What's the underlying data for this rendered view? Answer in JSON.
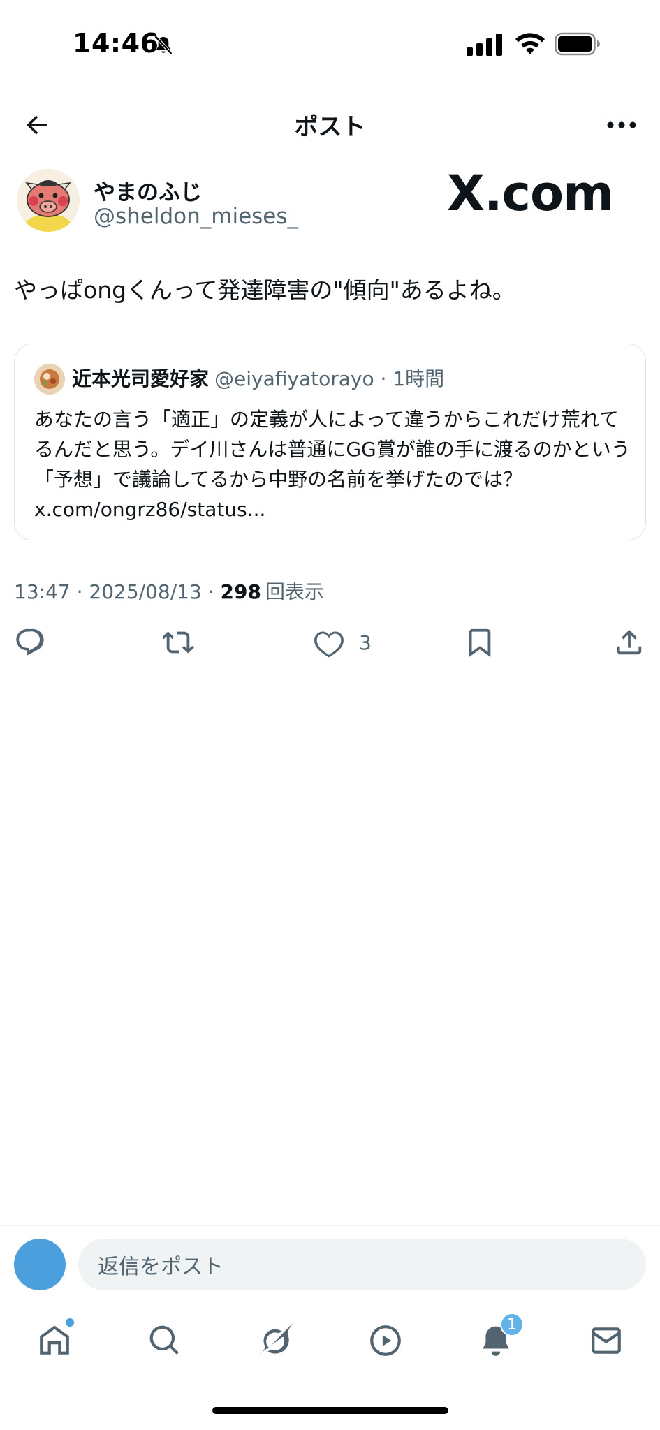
{
  "status_bar": {
    "time": "14:46"
  },
  "header": {
    "title": "ポスト"
  },
  "post": {
    "author_name": "やまのふじ",
    "author_handle": "@sheldon_mieses_",
    "watermark": "X.com",
    "text": "やっぱongくんって発達障害の\"傾向\"あるよね。",
    "timestamp": "13:47 · 2025/08/13 · ",
    "views_count": "298",
    "views_label": "回表示",
    "like_count": "3"
  },
  "quote": {
    "name": "近本光司愛好家",
    "handle": "@eiyafiyatorayo",
    "separator": "·",
    "time": "1時間",
    "text": "あなたの言う「適正」の定義が人によって違うからこれだけ荒れてるんだと思う。デイ川さんは普通にGG賞が誰の手に渡るのかという「予想」で議論してるから中野の名前を挙げたのでは？ x.com/ongrz86/status..."
  },
  "reply": {
    "placeholder": "返信をポスト"
  },
  "tabbar": {
    "notifications_badge": "1"
  },
  "colors": {
    "accent": "#4a9fdc",
    "secondary_text": "#536471",
    "primary_text": "#0f1419"
  },
  "icons": {
    "back": "arrow-left-icon",
    "more": "more-horizontal-icon",
    "reply": "reply-icon",
    "repost": "repost-icon",
    "like": "heart-icon",
    "bookmark": "bookmark-icon",
    "share": "share-icon",
    "home": "home-icon",
    "search": "search-icon",
    "grok": "grok-icon",
    "video": "play-icon",
    "notifications": "bell-icon",
    "messages": "mail-icon"
  }
}
